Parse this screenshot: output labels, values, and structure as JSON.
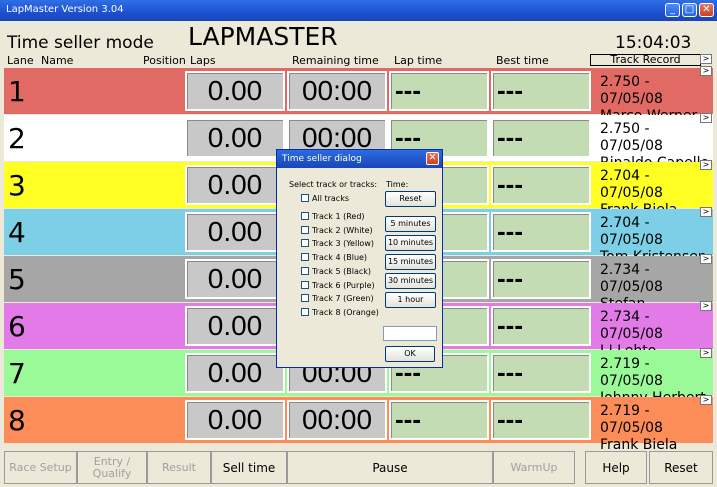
{
  "window": {
    "title": "LapMaster Version 3.04"
  },
  "header": {
    "mode": "Time seller mode",
    "app_name": "LAPMASTER",
    "clock": "15:04:03"
  },
  "columns": {
    "lane": "Lane",
    "name": "Name",
    "position": "Position",
    "laps": "Laps",
    "remaining": "Remaining time",
    "lap_time": "Lap time",
    "best_time": "Best time",
    "track_record": "Track Record"
  },
  "lanes": [
    {
      "number": "1",
      "laps": "0.00",
      "remaining": "00:00",
      "lap_time": "---",
      "best_time": "---",
      "record": "2.750 - 07/05/08",
      "record_holder": "Marco Werner",
      "color": "#e26a64"
    },
    {
      "number": "2",
      "laps": "0.00",
      "remaining": "00:00",
      "lap_time": "---",
      "best_time": "---",
      "record": "2.750 - 07/05/08",
      "record_holder": "Rinaldo Capello",
      "color": "#ffffff"
    },
    {
      "number": "3",
      "laps": "0.00",
      "remaining": "",
      "lap_time": "",
      "best_time": "---",
      "record": "2.704 - 07/05/08",
      "record_holder": "Frank Biela",
      "color": "#ffff24"
    },
    {
      "number": "4",
      "laps": "0.00",
      "remaining": "",
      "lap_time": "",
      "best_time": "---",
      "record": "2.704 - 07/05/08",
      "record_holder": "Tom Kristensen",
      "color": "#7ccfe6"
    },
    {
      "number": "5",
      "laps": "0.00",
      "remaining": "",
      "lap_time": "",
      "best_time": "---",
      "record": "2.734 - 07/05/08",
      "record_holder": "Stefan Johanson",
      "color": "#a6a6a6"
    },
    {
      "number": "6",
      "laps": "0.00",
      "remaining": "",
      "lap_time": "",
      "best_time": "---",
      "record": "2.734 - 07/05/08",
      "record_holder": "J J Lehto",
      "color": "#e27ae8"
    },
    {
      "number": "7",
      "laps": "0.00",
      "remaining": "00:00",
      "lap_time": "---",
      "best_time": "---",
      "record": "2.719 - 07/05/08",
      "record_holder": "Johnny Herbert",
      "color": "#9afa98"
    },
    {
      "number": "8",
      "laps": "0.00",
      "remaining": "00:00",
      "lap_time": "---",
      "best_time": "---",
      "record": "2.719 - 07/05/08",
      "record_holder": "Frank Biela",
      "color": "#fc8c58"
    }
  ],
  "buttons": {
    "race_setup": "Race Setup",
    "entry_qualify": "Entry / Qualify",
    "result": "Result",
    "sell_time": "Sell time",
    "pause": "Pause",
    "warmup": "WarmUp",
    "help": "Help",
    "reset": "Reset"
  },
  "dialog": {
    "title": "Time seller dialog",
    "select_label": "Select track or tracks:",
    "time_label": "Time:",
    "all_tracks": "All tracks",
    "tracks": [
      "Track 1 (Red)",
      "Track 2 (White)",
      "Track 3 (Yellow)",
      "Track 4 (Blue)",
      "Track 5 (Black)",
      "Track 6 (Purple)",
      "Track 7 (Green)",
      "Track 8 (Orange)"
    ],
    "time_buttons": [
      "Reset",
      "5 minutes",
      "10 minutes",
      "15 minutes",
      "30 minutes",
      "1 hour"
    ],
    "ok": "OK",
    "time_value": ""
  }
}
